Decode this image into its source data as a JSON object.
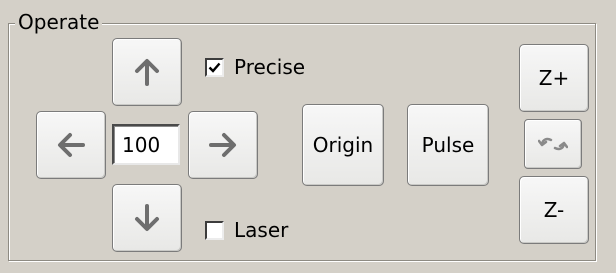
{
  "group": {
    "title": "Operate"
  },
  "step": {
    "value": "100"
  },
  "checkboxes": {
    "precise": {
      "label": "Precise",
      "checked": true
    },
    "laser": {
      "label": "Laser",
      "checked": false
    }
  },
  "buttons": {
    "origin_label": "Origin",
    "pulse_label": "Pulse",
    "z_plus_label": "Z+",
    "z_minus_label": "Z-"
  },
  "icons": {
    "up": "arrow-up-icon",
    "down": "arrow-down-icon",
    "left": "arrow-left-icon",
    "right": "arrow-right-icon",
    "z_swap": "swap-arrows-icon"
  },
  "colors": {
    "panel_background": "#d4d0c8",
    "button_face": "#f2f2f0",
    "arrow_gray": "#6e6e6e"
  }
}
